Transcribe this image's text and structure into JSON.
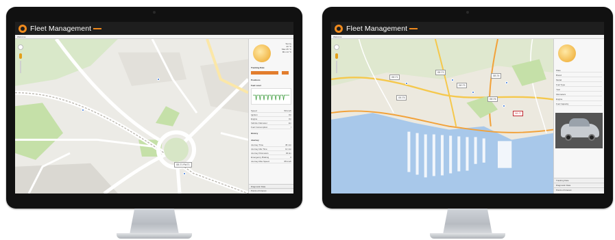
{
  "left_screen": {
    "app_title": "Fleet Management",
    "breadcrumb": "Welcome",
    "sidebar": {
      "weather_text": [
        "Sunny",
        "20 °C",
        "Max 25 °C",
        "Min 14 °C"
      ],
      "tracking_label": "Tracking Date",
      "positions_label": "Positions",
      "fuel_level_label": "Fuel Level",
      "details": [
        {
          "label": "Speed",
          "value": "50 km/h"
        },
        {
          "label": "Ignition",
          "value": "On"
        },
        {
          "label": "Engine",
          "value": "On"
        },
        {
          "label": "Vehicle Odometer",
          "value": "km"
        },
        {
          "label": "Fuel Consumption",
          "value": "l"
        }
      ],
      "history_label": "History",
      "journey_label": "Journey",
      "journey_rows": [
        {
          "label": "Journey Time",
          "value": "45 min"
        },
        {
          "label": "Journey Idle Time",
          "value": "12 min"
        },
        {
          "label": "Journey Kilometers",
          "value": "32 km"
        },
        {
          "label": "Emergency Braking",
          "value": "0"
        },
        {
          "label": "Journey Max Speed",
          "value": "95 km/h"
        }
      ],
      "footer_items": [
        "Diagnostic Data",
        "Points of Interest"
      ]
    },
    "marker_label": "GE-T1 FM-T1"
  },
  "right_screen": {
    "app_title": "Fleet Management",
    "breadcrumb": "Welcome",
    "sidebar": {
      "vehicle_details": [
        {
          "label": "Plate",
          "value": ""
        },
        {
          "label": "Brand",
          "value": ""
        },
        {
          "label": "Model",
          "value": ""
        },
        {
          "label": "Fuel Type",
          "value": ""
        },
        {
          "label": "Year",
          "value": ""
        },
        {
          "label": "Kilometers",
          "value": ""
        },
        {
          "label": "Engine",
          "value": ""
        },
        {
          "label": "Fuel Capacity",
          "value": ""
        }
      ],
      "footer_items": [
        "Tracking Date",
        "Diagnostic Data",
        "Points of Interest"
      ]
    },
    "markers": [
      {
        "label": "GE-T1"
      },
      {
        "label": "GE-T2"
      },
      {
        "label": "GE-T3"
      },
      {
        "label": "GE-T4"
      },
      {
        "label": "GE-T5"
      },
      {
        "label": "GE-T6"
      },
      {
        "label": "GE-T7"
      }
    ]
  },
  "colors": {
    "accent": "#e27d2d",
    "app_bar": "#1e1e1e",
    "sea": "#a8c8ea",
    "park": "#c5e0a8",
    "alert": "#c0262d"
  }
}
